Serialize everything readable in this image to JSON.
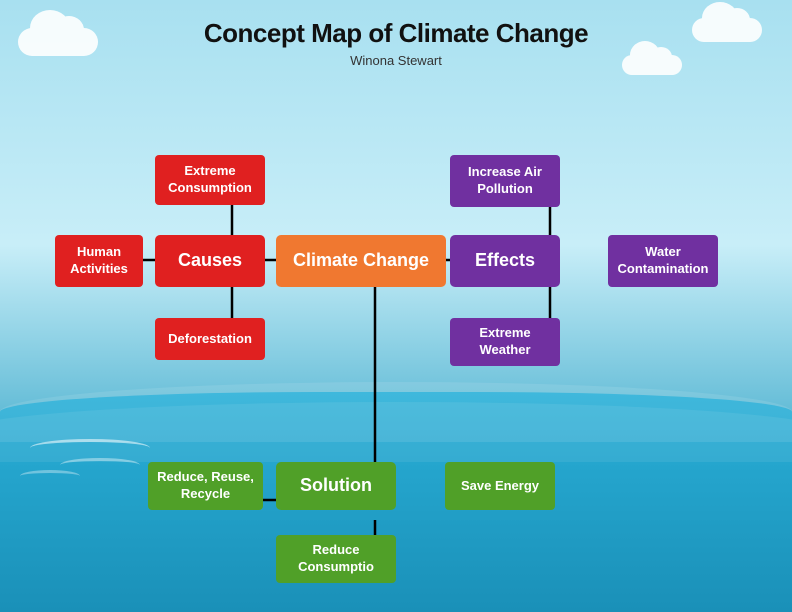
{
  "title": "Concept Map of Climate Change",
  "subtitle": "Winona Stewart",
  "boxes": {
    "climate_change": {
      "label": "Climate Change",
      "color": "orange"
    },
    "causes": {
      "label": "Causes",
      "color": "red"
    },
    "effects": {
      "label": "Effects",
      "color": "purple"
    },
    "solution": {
      "label": "Solution",
      "color": "green"
    },
    "human_activities": {
      "label": "Human Activities",
      "color": "red"
    },
    "extreme_consumption": {
      "label": "Extreme Consumption",
      "color": "red"
    },
    "deforestation": {
      "label": "Deforestation",
      "color": "red"
    },
    "increase_air_pollution": {
      "label": "Increase Air Pollution",
      "color": "purple"
    },
    "water_contamination": {
      "label": "Water Contamination",
      "color": "purple"
    },
    "extreme_weather": {
      "label": "Extreme Weather",
      "color": "purple"
    },
    "reduce_reuse_recycle": {
      "label": "Reduce, Reuse, Recycle",
      "color": "green"
    },
    "save_energy": {
      "label": "Save Energy",
      "color": "green"
    },
    "reduce_consumption": {
      "label": "Reduce Consumptio",
      "color": "green"
    }
  }
}
